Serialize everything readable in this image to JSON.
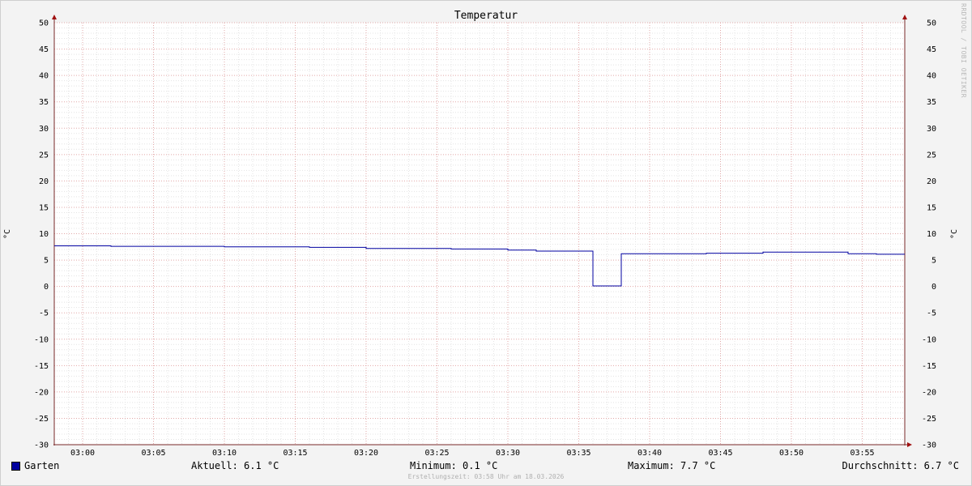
{
  "chart_data": {
    "type": "line",
    "title": "Temperatur",
    "ylabel": "°C",
    "ylabel_right": "°C",
    "xlabel": "",
    "ylim": [
      -30,
      50
    ],
    "yticks": [
      -30,
      -25,
      -20,
      -15,
      -10,
      -5,
      0,
      5,
      10,
      15,
      20,
      25,
      30,
      35,
      40,
      45,
      50
    ],
    "xlim": [
      "02:58",
      "03:58"
    ],
    "xticks": [
      "03:00",
      "03:05",
      "03:10",
      "03:15",
      "03:20",
      "03:25",
      "03:30",
      "03:35",
      "03:40",
      "03:45",
      "03:50",
      "03:55"
    ],
    "grid": true,
    "legend_position": "bottom-left",
    "series": [
      {
        "name": "Garten",
        "color": "#0000a0",
        "step": true,
        "x": [
          "02:58",
          "03:02",
          "03:10",
          "03:16",
          "03:20",
          "03:26",
          "03:30",
          "03:32",
          "03:36",
          "03:38",
          "03:44",
          "03:48",
          "03:54",
          "03:56"
        ],
        "values": [
          7.7,
          7.6,
          7.5,
          7.4,
          7.2,
          7.1,
          6.9,
          6.7,
          0.1,
          6.2,
          6.3,
          6.5,
          6.2,
          6.1
        ],
        "end_x": "03:58"
      }
    ],
    "stats": {
      "current": "Aktuell: 6.1 °C",
      "minimum": "Minimum: 0.1 °C",
      "maximum": "Maximum: 7.7 °C",
      "average": "Durchschnitt: 6.7 °C"
    }
  },
  "legend": {
    "series_label": "Garten"
  },
  "footer": {
    "created": "Erstellungszeit: 03:58 Uhr am 18.03.2026",
    "watermark": "RRDTOOL / TOBI OETIKER"
  }
}
